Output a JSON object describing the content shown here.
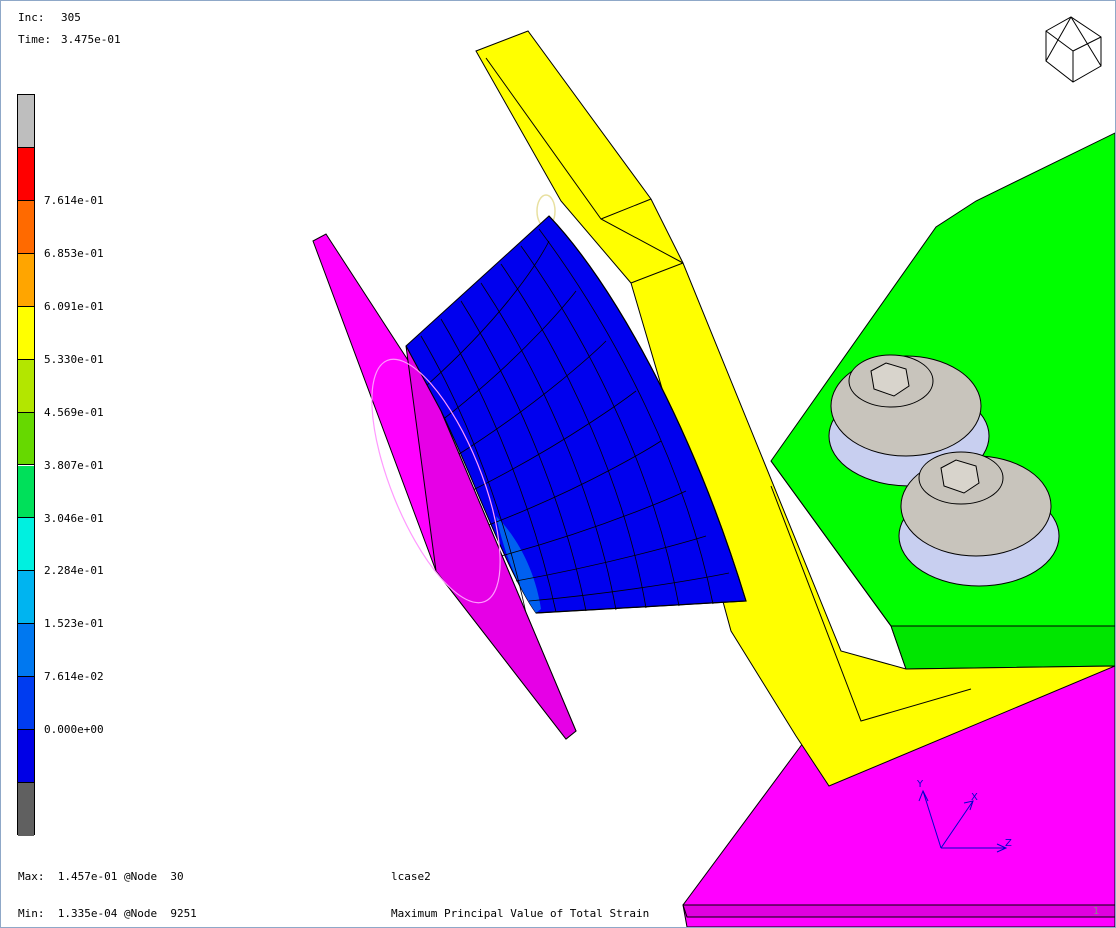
{
  "header": {
    "inc_label": "Inc:",
    "inc_value": "305",
    "time_label": "Time:",
    "time_value": "3.475e-01"
  },
  "legend": {
    "colors": [
      "#bebebe",
      "#ff0000",
      "#ff6a00",
      "#ffa500",
      "#ffff00",
      "#b3e600",
      "#66d900",
      "#00e05a",
      "#00f0e0",
      "#00b4f0",
      "#0078f0",
      "#003cf0",
      "#0000e6",
      "#606060"
    ],
    "labels": [
      "7.614e-01",
      "6.853e-01",
      "6.091e-01",
      "5.330e-01",
      "4.569e-01",
      "3.807e-01",
      "3.046e-01",
      "2.284e-01",
      "1.523e-01",
      "7.614e-02",
      "0.000e+00"
    ]
  },
  "footer": {
    "max": "Max:  1.457e-01 @Node  30",
    "min": "Min:  1.335e-04 @Node  9251",
    "lcase": "lcase2",
    "quantity": "Maximum Principal Value of Total Strain"
  },
  "axes": {
    "y": "Y",
    "x": "X",
    "z": "Z"
  },
  "corner_number": "1",
  "scene_colors": {
    "green_block": "#00ff00",
    "magenta": "#ff00ff",
    "yellow": "#ffff00",
    "mesh_blue": "#0000ee",
    "bolt_gray": "#c8c4bc",
    "washer": "#c8cff0"
  }
}
